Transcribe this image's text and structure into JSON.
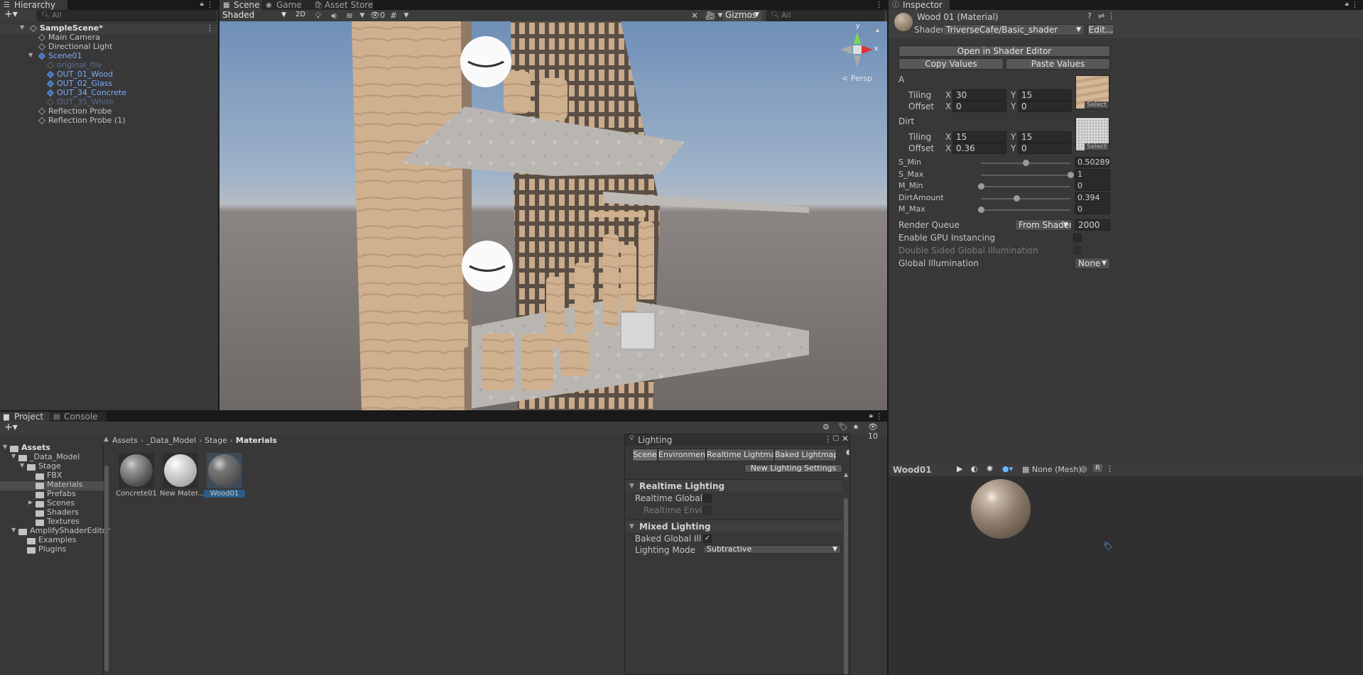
{
  "hierarchy": {
    "tab": "Hierarchy",
    "search_placeholder": "All",
    "items": [
      {
        "label": "SampleScene*",
        "depth": 0,
        "kind": "scene"
      },
      {
        "label": "Main Camera",
        "depth": 1,
        "kind": "object"
      },
      {
        "label": "Directional Light",
        "depth": 1,
        "kind": "object"
      },
      {
        "label": "Scene01",
        "depth": 1,
        "kind": "prefab"
      },
      {
        "label": "original_file",
        "depth": 2,
        "kind": "faded"
      },
      {
        "label": "OUT_01_Wood",
        "depth": 2,
        "kind": "prefab"
      },
      {
        "label": "OUT_02_Glass",
        "depth": 2,
        "kind": "prefab"
      },
      {
        "label": "OUT_34_Concrete",
        "depth": 2,
        "kind": "prefab"
      },
      {
        "label": "OUT_35_White",
        "depth": 2,
        "kind": "faded"
      },
      {
        "label": "Reflection Probe",
        "depth": 1,
        "kind": "object"
      },
      {
        "label": "Reflection Probe (1)",
        "depth": 1,
        "kind": "object"
      }
    ]
  },
  "scene": {
    "tabs": [
      "Scene",
      "Game",
      "Asset Store"
    ],
    "shading_mode": "Shaded",
    "mode_2d": "2D",
    "hidden_count": "0",
    "gizmos": "Gizmos",
    "search_placeholder": "All",
    "persp_label": "< Persp",
    "axis_x": "x",
    "axis_y": "y"
  },
  "inspector": {
    "tab": "Inspector",
    "material_name": "Wood 01 (Material)",
    "shader_label": "Shader",
    "shader_value": "TriverseCafe/Basic_shader",
    "edit_button": "Edit...",
    "open_shader_editor": "Open in Shader Editor",
    "copy_values": "Copy Values",
    "paste_values": "Paste Values",
    "tex_a": {
      "label": "A",
      "tiling_label": "Tiling",
      "offset_label": "Offset",
      "tiling_x": "30",
      "tiling_y": "15",
      "offset_x": "0",
      "offset_y": "0",
      "select": "Select"
    },
    "tex_dirt": {
      "label": "Dirt",
      "tiling_label": "Tiling",
      "offset_label": "Offset",
      "tiling_x": "15",
      "tiling_y": "15",
      "offset_x": "0.36",
      "offset_y": "0",
      "select": "Select"
    },
    "x_label": "X",
    "y_label": "Y",
    "sliders": [
      {
        "label": "S_Min",
        "value": "0.5028936",
        "fraction": 0.5028936
      },
      {
        "label": "S_Max",
        "value": "1",
        "fraction": 1.0
      },
      {
        "label": "M_Min",
        "value": "0",
        "fraction": 0.0
      },
      {
        "label": "DirtAmount",
        "value": "0.394",
        "fraction": 0.394
      },
      {
        "label": "M_Max",
        "value": "0",
        "fraction": 0.0
      }
    ],
    "render_queue_label": "Render Queue",
    "render_queue_mode": "From Shader",
    "render_queue_value": "2000",
    "gpu_instancing_label": "Enable GPU Instancing",
    "double_sided_label": "Double Sided Global Illumination",
    "global_illum_label": "Global Illumination",
    "global_illum_value": "None",
    "preview_name": "Wood01",
    "preview_mesh": "None (Mesh)",
    "preview_r": "R"
  },
  "project": {
    "tabs": [
      "Project",
      "Console"
    ],
    "hidden_count": "10",
    "breadcrumb": [
      "Assets",
      "_Data_Model",
      "Stage",
      "Materials"
    ],
    "tree": [
      {
        "label": "Assets",
        "depth": 0,
        "bold": true
      },
      {
        "label": "_Data_Model",
        "depth": 1
      },
      {
        "label": "Stage",
        "depth": 2
      },
      {
        "label": "FBX",
        "depth": 3
      },
      {
        "label": "Materials",
        "depth": 3,
        "selected": true
      },
      {
        "label": "Prefabs",
        "depth": 3
      },
      {
        "label": "Scenes",
        "depth": 3
      },
      {
        "label": "Shaders",
        "depth": 3
      },
      {
        "label": "Textures",
        "depth": 3
      },
      {
        "label": "AmplifyShaderEditor",
        "depth": 1
      },
      {
        "label": "Examples",
        "depth": 2
      },
      {
        "label": "Plugins",
        "depth": 2
      }
    ],
    "assets": [
      {
        "label": "Concrete01"
      },
      {
        "label": "New Mater..."
      },
      {
        "label": "Wood01"
      }
    ]
  },
  "lighting": {
    "title": "Lighting",
    "tabs": [
      "Scene",
      "Environment",
      "Realtime Lightmaps",
      "Baked Lightmaps"
    ],
    "new_settings": "New Lighting Settings",
    "realtime_header": "Realtime Lighting",
    "realtime_gi": "Realtime Global Illum",
    "realtime_env": "Realtime Environm",
    "mixed_header": "Mixed Lighting",
    "baked_gi": "Baked Global Illumin",
    "lighting_mode_label": "Lighting Mode",
    "lighting_mode_value": "Subtractive"
  },
  "colors": {
    "panel": "#383838",
    "selected_row": "#2c5d87",
    "prefab_blue": "#7cabff"
  }
}
